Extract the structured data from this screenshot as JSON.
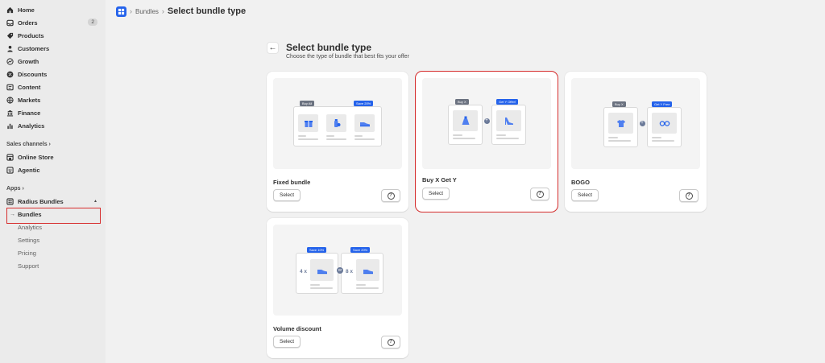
{
  "sidebar": {
    "main_items": [
      {
        "label": "Home",
        "icon": "home-icon"
      },
      {
        "label": "Orders",
        "icon": "inbox-icon",
        "badge": "2"
      },
      {
        "label": "Products",
        "icon": "tag-icon"
      },
      {
        "label": "Customers",
        "icon": "person-icon"
      },
      {
        "label": "Growth",
        "icon": "growth-icon"
      },
      {
        "label": "Discounts",
        "icon": "discount-icon"
      },
      {
        "label": "Content",
        "icon": "content-icon"
      },
      {
        "label": "Markets",
        "icon": "globe-icon"
      },
      {
        "label": "Finance",
        "icon": "bank-icon"
      },
      {
        "label": "Analytics",
        "icon": "bar-chart-icon"
      }
    ],
    "sales_channels_label": "Sales channels",
    "sales_channels": [
      {
        "label": "Online Store",
        "icon": "store-icon"
      },
      {
        "label": "Agentic",
        "icon": "agentic-icon"
      }
    ],
    "apps_label": "Apps",
    "app_name": "Radius Bundles",
    "app_sub_items": [
      "Bundles",
      "Analytics",
      "Settings",
      "Pricing",
      "Support"
    ],
    "active_sub_item": "Bundles"
  },
  "breadcrumb": {
    "parent": "Bundles",
    "current": "Select bundle type"
  },
  "page": {
    "title": "Select bundle type",
    "subtitle": "Choose the type of bundle that best fits your offer"
  },
  "cards": [
    {
      "title": "Fixed bundle",
      "select_label": "Select",
      "tags": [
        "Buy All",
        "Save 20%"
      ]
    },
    {
      "title": "Buy X Get Y",
      "select_label": "Select",
      "tags": [
        "Buy X",
        "Get Y Offer!"
      ]
    },
    {
      "title": "BOGO",
      "select_label": "Select",
      "tags": [
        "Buy X",
        "Get Y Free"
      ]
    },
    {
      "title": "Volume discount",
      "select_label": "Select",
      "tags": [
        "Save 10%",
        "Save 20%"
      ],
      "quantities": [
        "4 x",
        "8 x"
      ]
    }
  ],
  "colors": {
    "accent": "#2563eb",
    "highlight": "#d62d2d",
    "sidebar_bg": "#ebebeb",
    "page_bg": "#f1f1f1"
  }
}
